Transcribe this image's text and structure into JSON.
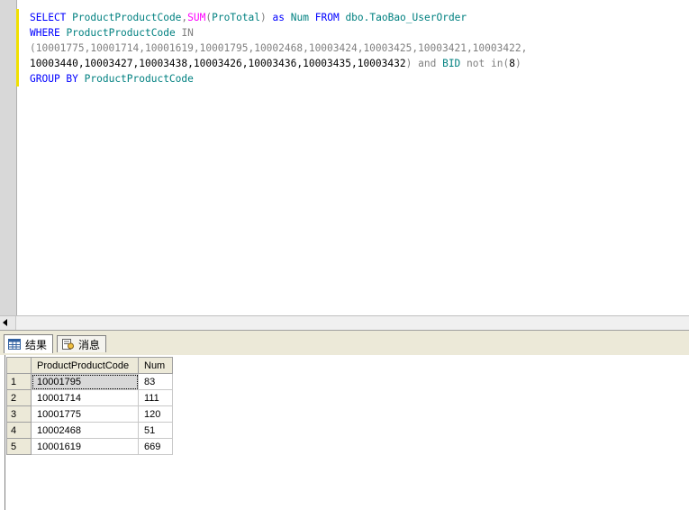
{
  "editor": {
    "line1": {
      "select": "SELECT",
      "col": "ProductProductCode",
      "comma": ",",
      "sum": "SUM",
      "lparen": "(",
      "protot": "ProTotal",
      "rparen": ")",
      "as": "as",
      "alias": "Num",
      "from": "FROM",
      "table": "dbo.TaoBao_UserOrder"
    },
    "line2": {
      "where": "WHERE",
      "col": "ProductProductCode",
      "in": "IN"
    },
    "line3": "(10001775,10001714,10001619,10001795,10002468,10003424,10003425,10003421,10003422,",
    "line4": {
      "values": "10003440,10003427,10003438,10003426,10003436,10003435,10003432",
      "rparen": ")",
      "and": "and",
      "bid": "BID",
      "not": "not",
      "in": "in",
      "lp": "(",
      "eight": "8",
      "rp": ")"
    },
    "line5": {
      "group_by": "GROUP BY",
      "col": "ProductProductCode"
    }
  },
  "tabs": [
    {
      "label": "结果",
      "icon": "grid-icon",
      "active": true
    },
    {
      "label": "消息",
      "icon": "message-icon",
      "active": false
    }
  ],
  "results": {
    "columns": [
      "ProductProductCode",
      "Num"
    ],
    "rows": [
      {
        "n": "1",
        "code": "10001795",
        "num": "83"
      },
      {
        "n": "2",
        "code": "10001714",
        "num": "111"
      },
      {
        "n": "3",
        "code": "10001775",
        "num": "120"
      },
      {
        "n": "4",
        "code": "10002468",
        "num": "51"
      },
      {
        "n": "5",
        "code": "10001619",
        "num": "669"
      }
    ]
  },
  "colors": {
    "keyword": "#0000ff",
    "identifier": "#008080",
    "function": "#ff00ff",
    "operator": "#808080",
    "change_bar": "#f0e000"
  }
}
